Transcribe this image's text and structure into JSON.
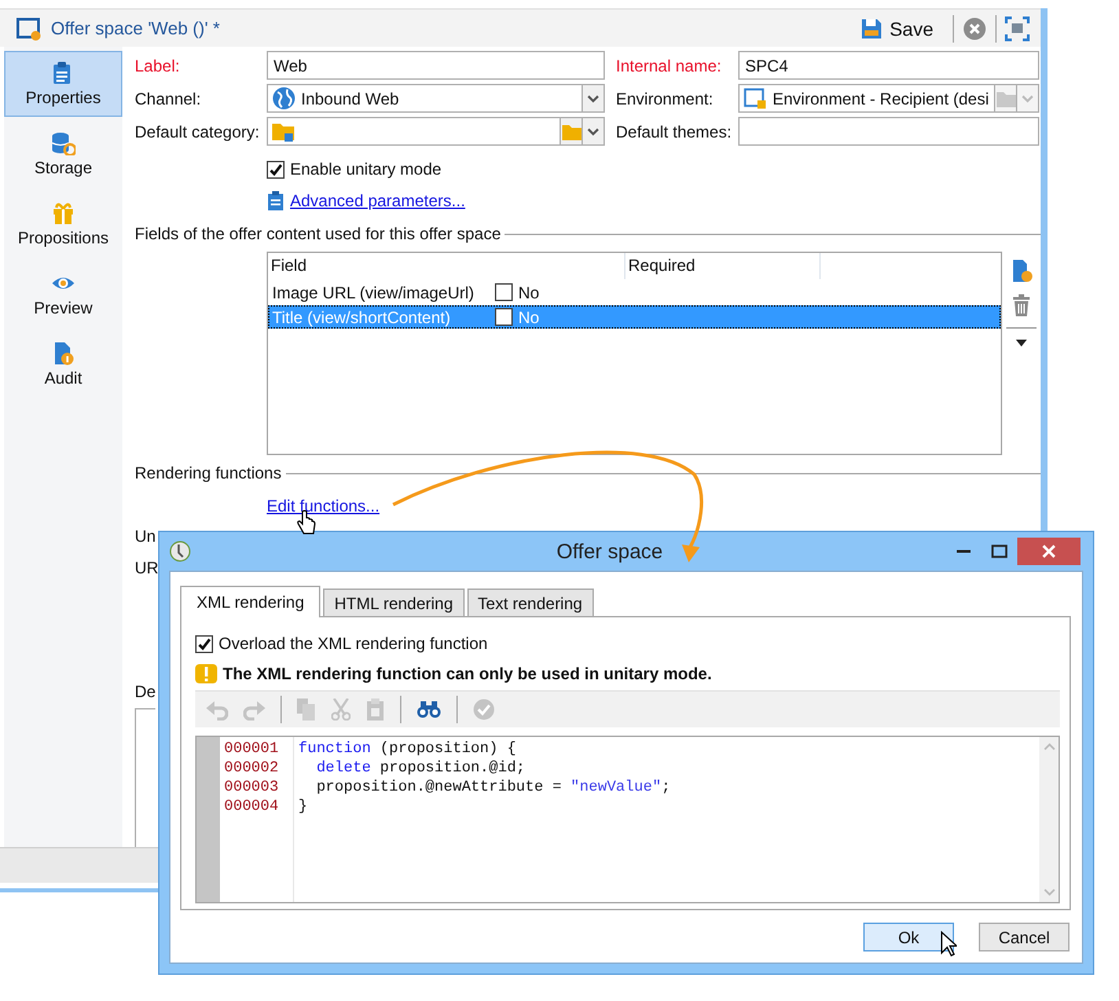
{
  "editor": {
    "title": "Offer space 'Web ()' *",
    "save_label": "Save"
  },
  "sidebar": {
    "items": [
      {
        "label": "Properties",
        "selected": true
      },
      {
        "label": "Storage",
        "selected": false
      },
      {
        "label": "Propositions",
        "selected": false
      },
      {
        "label": "Preview",
        "selected": false
      },
      {
        "label": "Audit",
        "selected": false
      }
    ]
  },
  "fields": [
    {
      "label": "Label:",
      "required": true,
      "kind": "text",
      "value": "Web"
    },
    {
      "label": "Internal name:",
      "required": true,
      "kind": "text",
      "value": "SPC4"
    },
    {
      "label": "Channel:",
      "required": false,
      "kind": "combo",
      "value": "Inbound Web"
    },
    {
      "label": "Environment:",
      "required": false,
      "kind": "link-combo",
      "value": "Environment - Recipient (desi"
    },
    {
      "label": "Default category:",
      "required": false,
      "kind": "folder-combo"
    },
    {
      "label": "Default themes:",
      "required": false,
      "kind": "text"
    }
  ],
  "unitary_mode": {
    "label": "Enable unitary mode",
    "checked": true
  },
  "advanced_link": "Advanced parameters...",
  "content_section": {
    "title": "Fields of the offer content used for this offer space",
    "columns": [
      "Field",
      "Required"
    ],
    "rows": [
      {
        "field": "Image URL (view/imageUrl)",
        "required": false,
        "required_label": "No",
        "selected": false
      },
      {
        "field": "Title (view/shortContent)",
        "required": false,
        "required_label": "No",
        "selected": true
      }
    ]
  },
  "rendering_section": {
    "title": "Rendering functions",
    "link": "Edit functions..."
  },
  "partial_labels": [
    "Un",
    "UR",
    "De"
  ],
  "dialog": {
    "title": "Offer space",
    "tabs": [
      {
        "label": "XML rendering",
        "selected": true
      },
      {
        "label": "HTML rendering",
        "selected": false
      },
      {
        "label": "Text rendering",
        "selected": false
      }
    ],
    "overload": {
      "label": "Overload the XML rendering function",
      "checked": true
    },
    "warning": "The XML rendering function can only be used in unitary mode.",
    "code_lines": [
      {
        "number": "000001",
        "tokens": [
          {
            "text": "function",
            "kind": "keyword"
          },
          {
            "text": " (proposition) {",
            "kind": "plain"
          }
        ]
      },
      {
        "number": "000002",
        "tokens": [
          {
            "text": "  delete",
            "kind": "keyword"
          },
          {
            "text": " proposition.@id;",
            "kind": "plain"
          }
        ]
      },
      {
        "number": "000003",
        "tokens": [
          {
            "text": "  proposition.@newAttribute = ",
            "kind": "plain"
          },
          {
            "text": "\"newValue\"",
            "kind": "string"
          },
          {
            "text": ";",
            "kind": "plain"
          }
        ]
      },
      {
        "number": "000004",
        "tokens": [
          {
            "text": "}",
            "kind": "plain"
          }
        ]
      }
    ],
    "buttons": [
      {
        "label": "Ok",
        "default": true
      },
      {
        "label": "Cancel",
        "default": false
      }
    ]
  }
}
